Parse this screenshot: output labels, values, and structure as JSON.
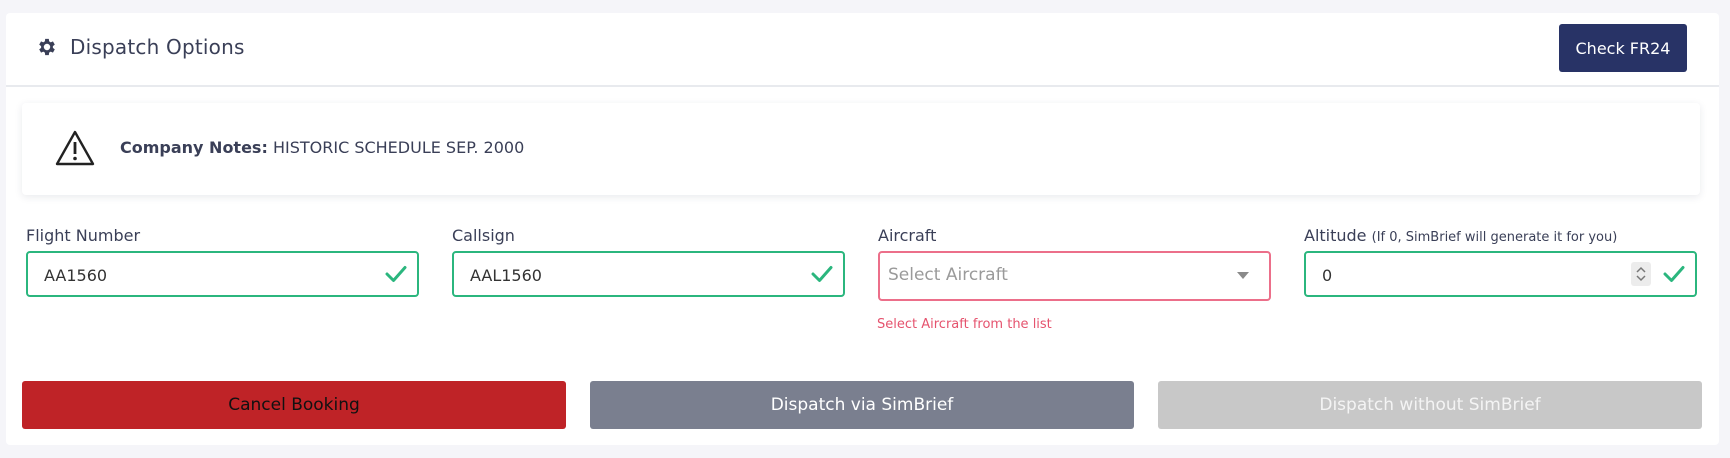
{
  "header": {
    "title": "Dispatch Options",
    "check_button": "Check FR24"
  },
  "notes": {
    "label": "Company Notes:",
    "text": "HISTORIC SCHEDULE SEP. 2000"
  },
  "fields": {
    "flight_number": {
      "label": "Flight Number",
      "value": "AA1560"
    },
    "callsign": {
      "label": "Callsign",
      "value": "AAL1560"
    },
    "aircraft": {
      "label": "Aircraft",
      "placeholder": "Select Aircraft",
      "error": "Select Aircraft from the list"
    },
    "altitude": {
      "label": "Altitude",
      "hint": "(If 0, SimBrief will generate it for you)",
      "value": "0"
    }
  },
  "actions": {
    "cancel": "Cancel Booking",
    "dispatch_simbrief": "Dispatch via SimBrief",
    "dispatch_no_simbrief": "Dispatch without SimBrief"
  },
  "colors": {
    "primary": "#283366",
    "valid": "#2bb67e",
    "invalid": "#ec6f8a",
    "danger": "#bf2327",
    "secondary": "#7a7f8f",
    "disabled": "#c8c8c8"
  },
  "icons": {
    "header": "gear-icon",
    "notes": "warning-icon",
    "valid": "check-icon",
    "dropdown": "caret-down-icon"
  }
}
